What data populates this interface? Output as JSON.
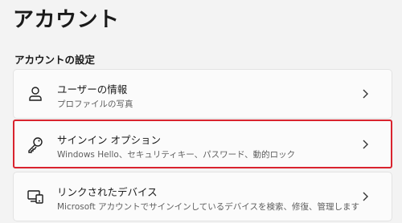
{
  "header": {
    "title": "アカウント"
  },
  "section": {
    "title": "アカウントの設定"
  },
  "items": [
    {
      "label": "ユーザーの情報",
      "description": "プロファイルの写真",
      "icon": "person-icon"
    },
    {
      "label": "サインイン オプション",
      "description": "Windows Hello、セキュリティキー、パスワード、動的ロック",
      "icon": "key-icon"
    },
    {
      "label": "リンクされたデバイス",
      "description": "Microsoft アカウントでサインインしているデバイスを検索、修復、管理します",
      "icon": "devices-icon"
    }
  ],
  "colors": {
    "highlight": "#d9232e",
    "background": "#f3f3f3",
    "card": "#fbfbfb"
  }
}
